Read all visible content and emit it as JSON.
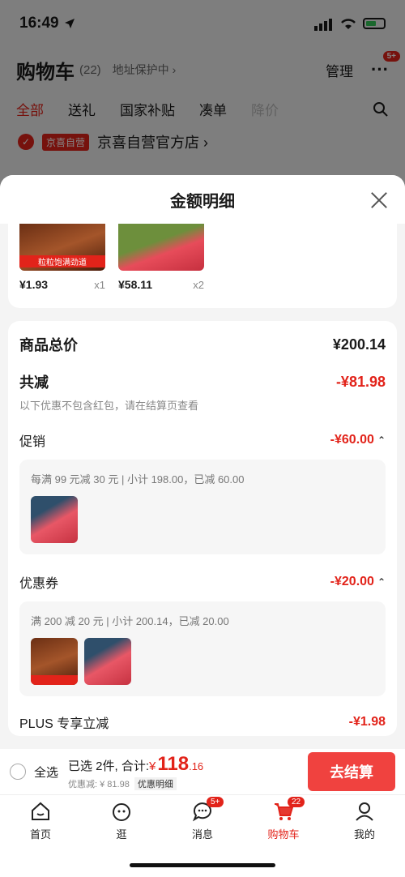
{
  "status": {
    "time": "16:49"
  },
  "cart": {
    "title": "购物车",
    "count": "(22)",
    "address_protect": "地址保护中 ›",
    "manage": "管理",
    "more_badge": "5+",
    "tabs": [
      "全部",
      "送礼",
      "国家补贴",
      "凑单",
      "降价"
    ],
    "store_tag": "京喜自营",
    "store_name": "京喜自营官方店 ›"
  },
  "sheet": {
    "title": "金额明细",
    "products": [
      {
        "price": "¥1.93",
        "qty": "x1",
        "label": "粒粒饱满劲道"
      },
      {
        "price": "¥58.11",
        "qty": "x2"
      }
    ],
    "total_label": "商品总价",
    "total_value": "¥200.14",
    "reduce_label": "共减",
    "reduce_value": "-¥81.98",
    "reduce_note": "以下优惠不包含红包，请在结算页查看",
    "promo_label": "促销",
    "promo_value": "-¥60.00",
    "promo_desc": "每满 99 元减 30 元 | 小计 198.00，已减 60.00",
    "coupon_label": "优惠券",
    "coupon_value": "-¥20.00",
    "coupon_desc": "满 200 减 20 元 | 小计 200.14，已减 20.00",
    "plus_label": "PLUS 专享立减",
    "plus_value": "-¥1.98"
  },
  "checkout": {
    "select_all": "全选",
    "selected_text": "已选 2件, 合计:",
    "currency": "¥",
    "amount": "118",
    "decimals": ".16",
    "discount_text": "优惠减: ¥ 81.98",
    "detail_chip": "优惠明细",
    "pay_button": "去结算"
  },
  "tabbar": {
    "items": [
      {
        "label": "首页"
      },
      {
        "label": "逛"
      },
      {
        "label": "消息",
        "badge": "5+"
      },
      {
        "label": "购物车",
        "badge": "22"
      },
      {
        "label": "我的"
      }
    ]
  },
  "colors": {
    "accent": "#e2231a",
    "pay_button": "#f0423f"
  }
}
